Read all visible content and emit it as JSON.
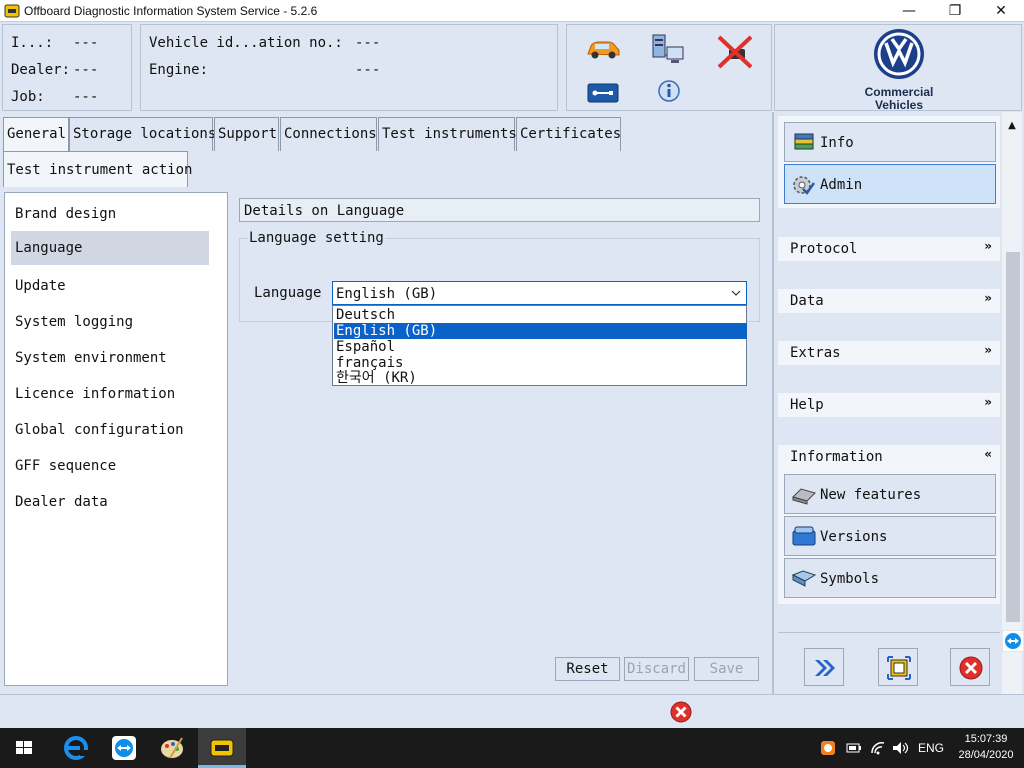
{
  "window": {
    "title": "Offboard Diagnostic Information System Service - 5.2.6",
    "controls": {
      "minimize": "—",
      "maximize": "❐",
      "close": "✕"
    }
  },
  "info": {
    "i_label": "I...:",
    "i_value": "---",
    "dealer_label": "Dealer:",
    "dealer_value": "---",
    "job_label": "Job:",
    "job_value": "---",
    "vin_label": "Vehicle id...ation no.:",
    "vin_value": "---",
    "engine_label": "Engine:",
    "engine_value": "---"
  },
  "icons": {
    "car": "car-icon",
    "network": "network-computer-icon",
    "no_connection": "disconnected-plug-icon",
    "usb": "usb-icon",
    "info": "info-icon"
  },
  "brand": {
    "line1": "Commercial",
    "line2": "Vehicles"
  },
  "tabs": [
    {
      "label": "General"
    },
    {
      "label": "Storage locations"
    },
    {
      "label": "Support"
    },
    {
      "label": "Connections"
    },
    {
      "label": "Test instruments"
    },
    {
      "label": "Certificates"
    },
    {
      "label": "Test instrument action"
    }
  ],
  "nav": {
    "items": [
      {
        "label": "Brand design"
      },
      {
        "label": "Language"
      },
      {
        "label": "Update"
      },
      {
        "label": "System logging"
      },
      {
        "label": "System environment"
      },
      {
        "label": "Licence information"
      },
      {
        "label": "Global configuration"
      },
      {
        "label": "GFF sequence"
      },
      {
        "label": "Dealer data"
      }
    ],
    "selected": "Language"
  },
  "details": {
    "header": "Details on Language",
    "group_title": "Language setting",
    "language_label": "Language",
    "selected_value": "English (GB)",
    "options": [
      "Deutsch",
      "English (GB)",
      "Español",
      "français",
      "한국어 (KR)"
    ],
    "highlighted": "English (GB)"
  },
  "buttons": {
    "reset": "Reset",
    "discard": "Discard",
    "save": "Save"
  },
  "right_panel": {
    "info": "Info",
    "admin": "Admin",
    "protocol": "Protocol",
    "data": "Data",
    "extras": "Extras",
    "help": "Help",
    "information": "Information",
    "new_features": "New features",
    "versions": "Versions",
    "symbols": "Symbols"
  },
  "taskbar": {
    "language": "ENG",
    "time": "15:07:39",
    "date": "28/04/2020"
  },
  "colors": {
    "background": "#dde6f2",
    "highlight": "#0a62c9",
    "admin_active": "#cfe3f8",
    "error_red": "#e0302b",
    "vw_blue": "#1c3f8c"
  }
}
